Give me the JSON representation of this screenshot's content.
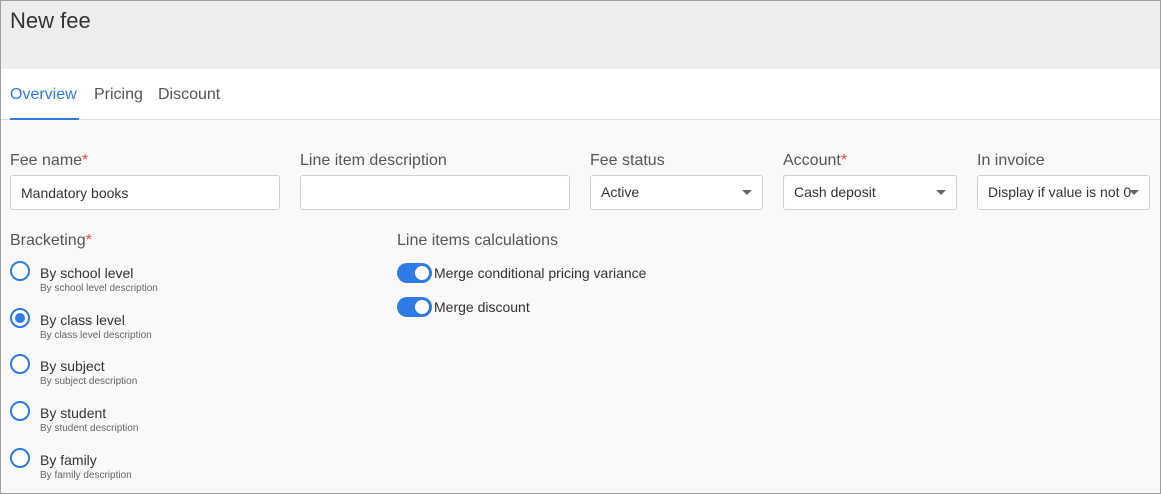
{
  "header": {
    "title": "New fee"
  },
  "tabs": [
    {
      "label": "Overview",
      "active": true
    },
    {
      "label": "Pricing",
      "active": false
    },
    {
      "label": "Discount",
      "active": false
    }
  ],
  "form": {
    "fee_name": {
      "label": "Fee name",
      "required": "*",
      "value": "Mandatory books"
    },
    "line_item_description": {
      "label": "Line item description",
      "value": ""
    },
    "fee_status": {
      "label": "Fee status",
      "value": "Active"
    },
    "account": {
      "label": "Account",
      "required": "*",
      "value": "Cash deposit"
    },
    "in_invoice": {
      "label": "In invoice",
      "value": "Display if value is not 0"
    }
  },
  "bracketing": {
    "label": "Bracketing",
    "required": "*",
    "options": [
      {
        "label": "By school level",
        "description": "By school level description",
        "checked": false
      },
      {
        "label": "By class level",
        "description": "By class level description",
        "checked": true
      },
      {
        "label": "By subject",
        "description": "By subject description",
        "checked": false
      },
      {
        "label": "By student",
        "description": "By student description",
        "checked": false
      },
      {
        "label": "By family",
        "description": "By family description",
        "checked": false
      }
    ]
  },
  "calculations": {
    "label": "Line items calculations",
    "toggles": [
      {
        "label": "Merge conditional pricing variance",
        "on": true
      },
      {
        "label": "Merge discount",
        "on": true
      }
    ]
  },
  "colors": {
    "accent": "#2d7be3",
    "required": "#e0494a",
    "header_bg": "#ededed"
  }
}
